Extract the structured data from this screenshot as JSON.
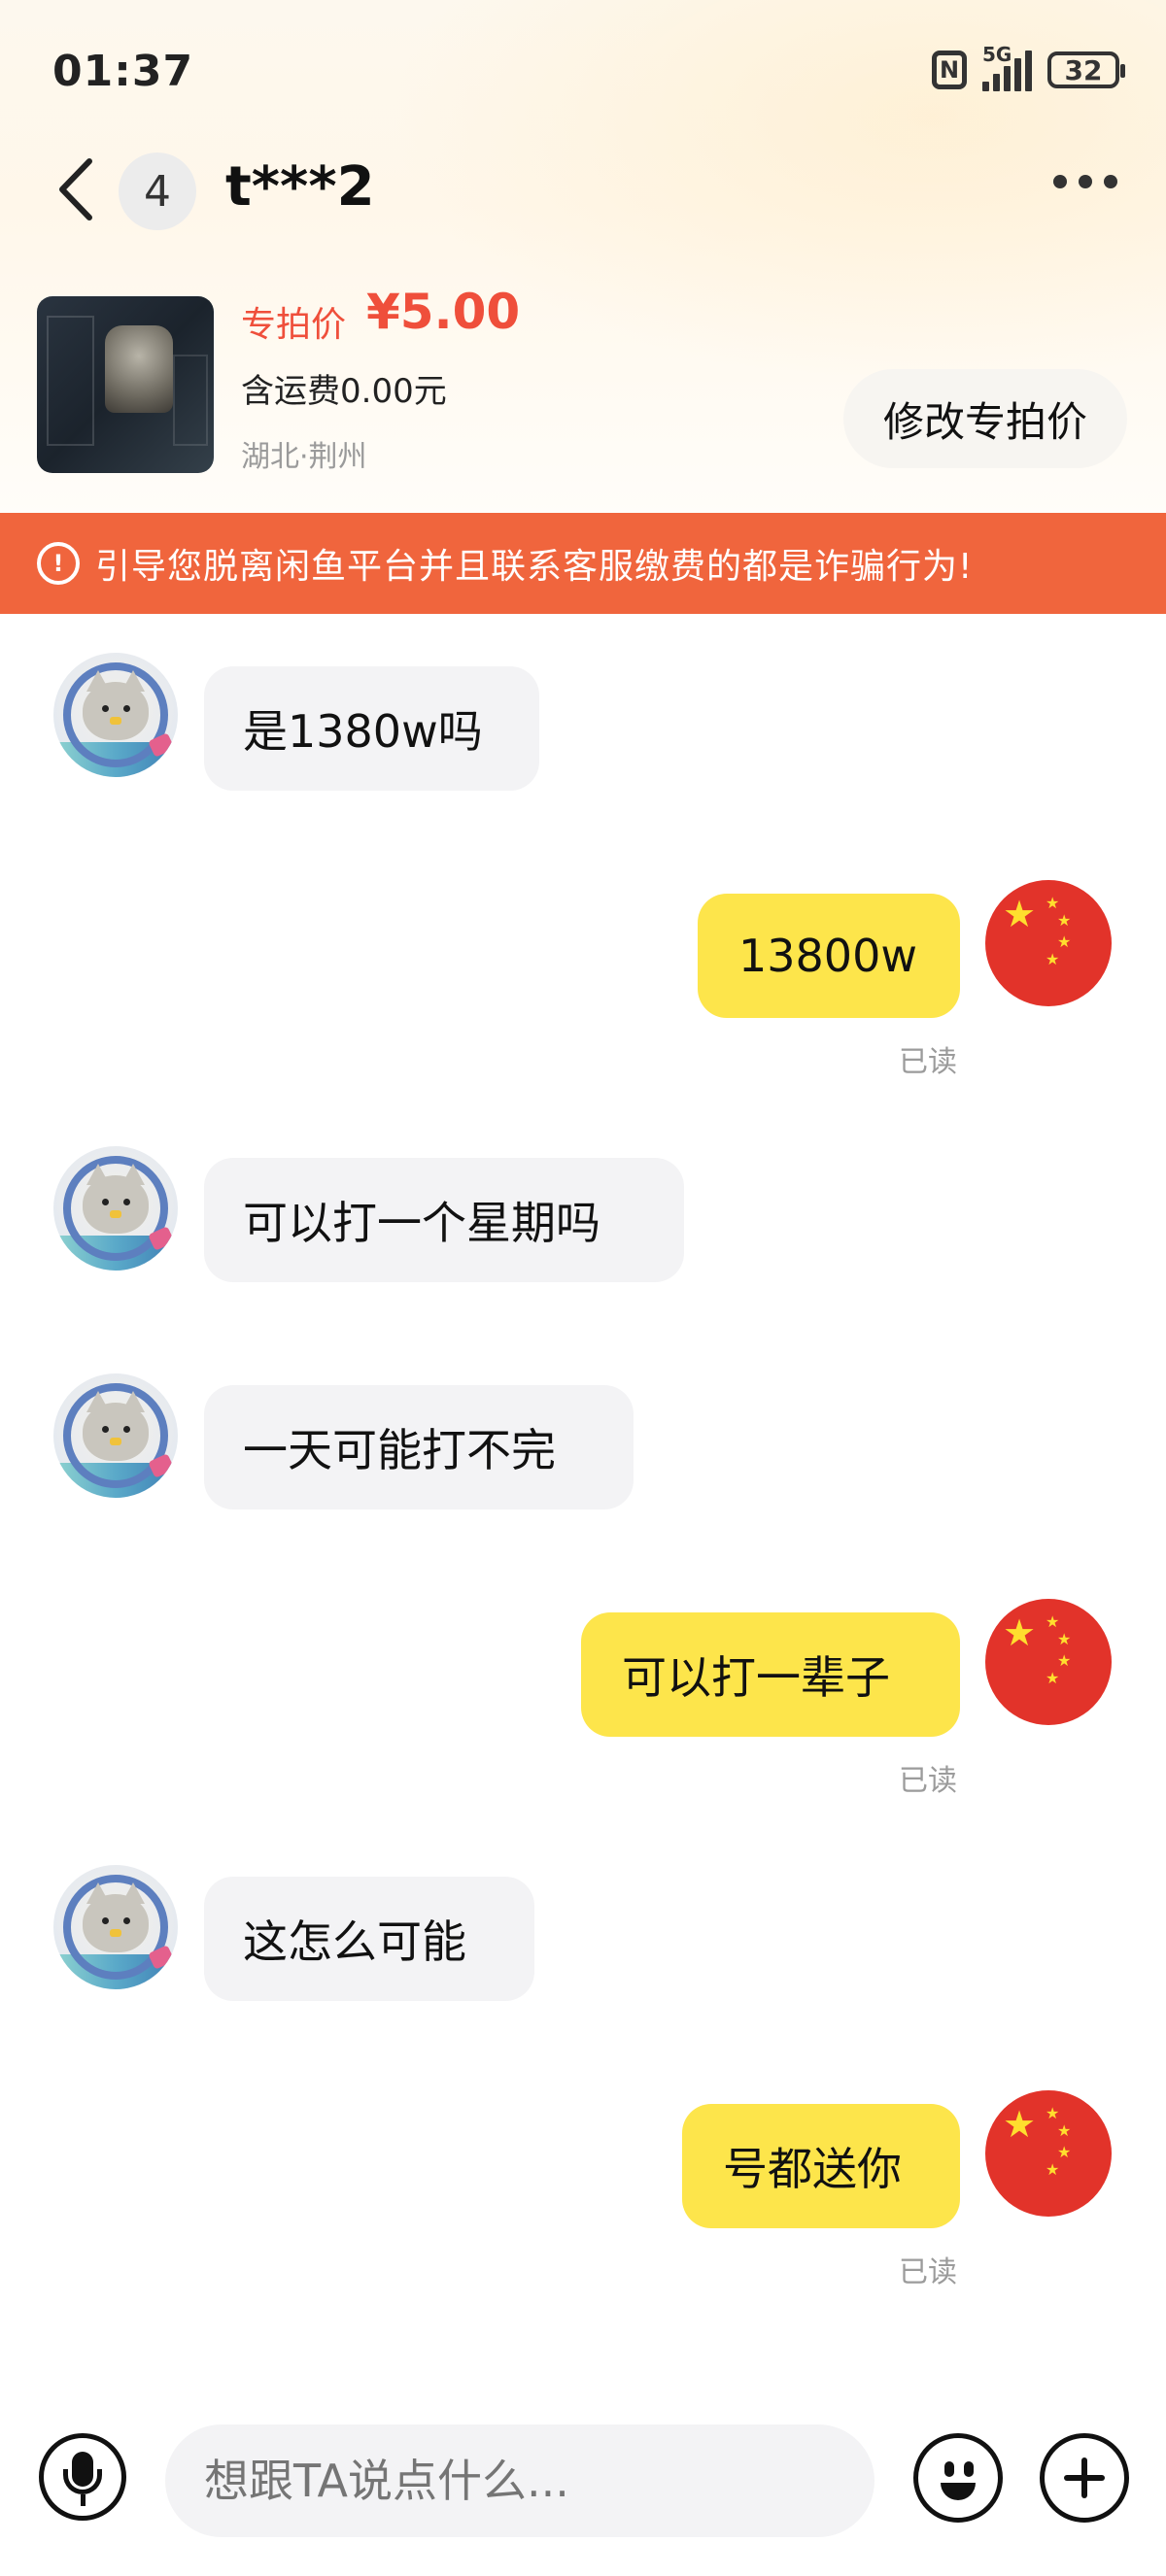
{
  "status_bar": {
    "time": "01:37",
    "network": "5G",
    "battery": "32"
  },
  "header": {
    "unread_count": "4",
    "contact_name": "t***2"
  },
  "product": {
    "price_label": "专拍价",
    "price": "¥5.00",
    "shipping": "含运费0.00元",
    "location": "湖北·荆州",
    "edit_button": "修改专拍价"
  },
  "warning": {
    "text": "引导您脱离闲鱼平台并且联系客服缴费的都是诈骗行为!"
  },
  "messages": [
    {
      "side": "left",
      "text": "是1380w吗"
    },
    {
      "side": "right",
      "text": "13800w",
      "status": "已读"
    },
    {
      "side": "left",
      "text": "可以打一个星期吗"
    },
    {
      "side": "left",
      "text": "一天可能打不完"
    },
    {
      "side": "right",
      "text": "可以打一辈子",
      "status": "已读"
    },
    {
      "side": "left",
      "text": "这怎么可能"
    },
    {
      "side": "right",
      "text": "号都送你",
      "status": "已读"
    }
  ],
  "input_bar": {
    "placeholder": "想跟TA说点什么..."
  },
  "colors": {
    "accent_yellow": "#fde54b",
    "warning_orange": "#f0653d",
    "price_red": "#ef4f3b"
  }
}
